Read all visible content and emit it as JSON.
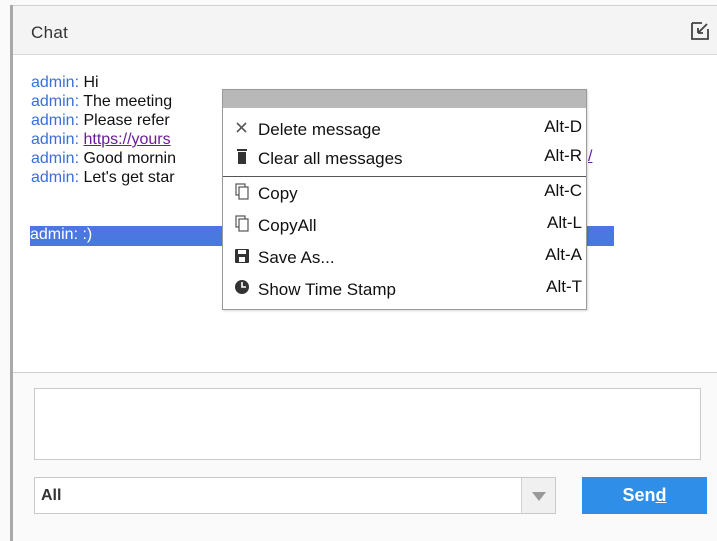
{
  "window": {
    "title": "Chat"
  },
  "messages": [
    {
      "sender": "admin:",
      "text": " Hi",
      "is_link": false,
      "selected": false
    },
    {
      "sender": "admin:",
      "text": " The meeting",
      "is_link": false,
      "selected": false
    },
    {
      "sender": "admin:",
      "text": " Please refer",
      "is_link": false,
      "selected": false
    },
    {
      "sender": "admin:",
      "text": "https://yours",
      "is_link": true,
      "selected": false
    },
    {
      "sender": "admin:",
      "text": " Good mornin",
      "is_link": false,
      "selected": false
    },
    {
      "sender": "admin:",
      "text": " Let's get star",
      "is_link": false,
      "selected": false
    },
    {
      "sender": "admin:",
      "text": " :)",
      "is_link": false,
      "selected": true
    }
  ],
  "link_tail": "/",
  "context_menu": {
    "items": [
      {
        "icon": "close-icon",
        "label": "Delete message",
        "shortcut": "Alt-D"
      },
      {
        "icon": "trash-icon",
        "label": "Clear all messages",
        "shortcut": "Alt-R"
      },
      {
        "icon": "copy-icon",
        "label": "Copy",
        "shortcut": "Alt-C"
      },
      {
        "icon": "copy-icon",
        "label": "CopyAll",
        "shortcut": "Alt-L"
      },
      {
        "icon": "save-icon",
        "label": "Save As...",
        "shortcut": "Alt-A"
      },
      {
        "icon": "clock-icon",
        "label": "Show Time Stamp",
        "shortcut": "Alt-T"
      }
    ]
  },
  "composer": {
    "input_value": "",
    "recipient": "All",
    "send_label_prefix": "Sen",
    "send_label_underlined": "d"
  },
  "colors": {
    "accent": "#2f8ee8",
    "selection": "#4a78e0",
    "sender": "#3a6fd8",
    "link": "#6a1b9a"
  }
}
